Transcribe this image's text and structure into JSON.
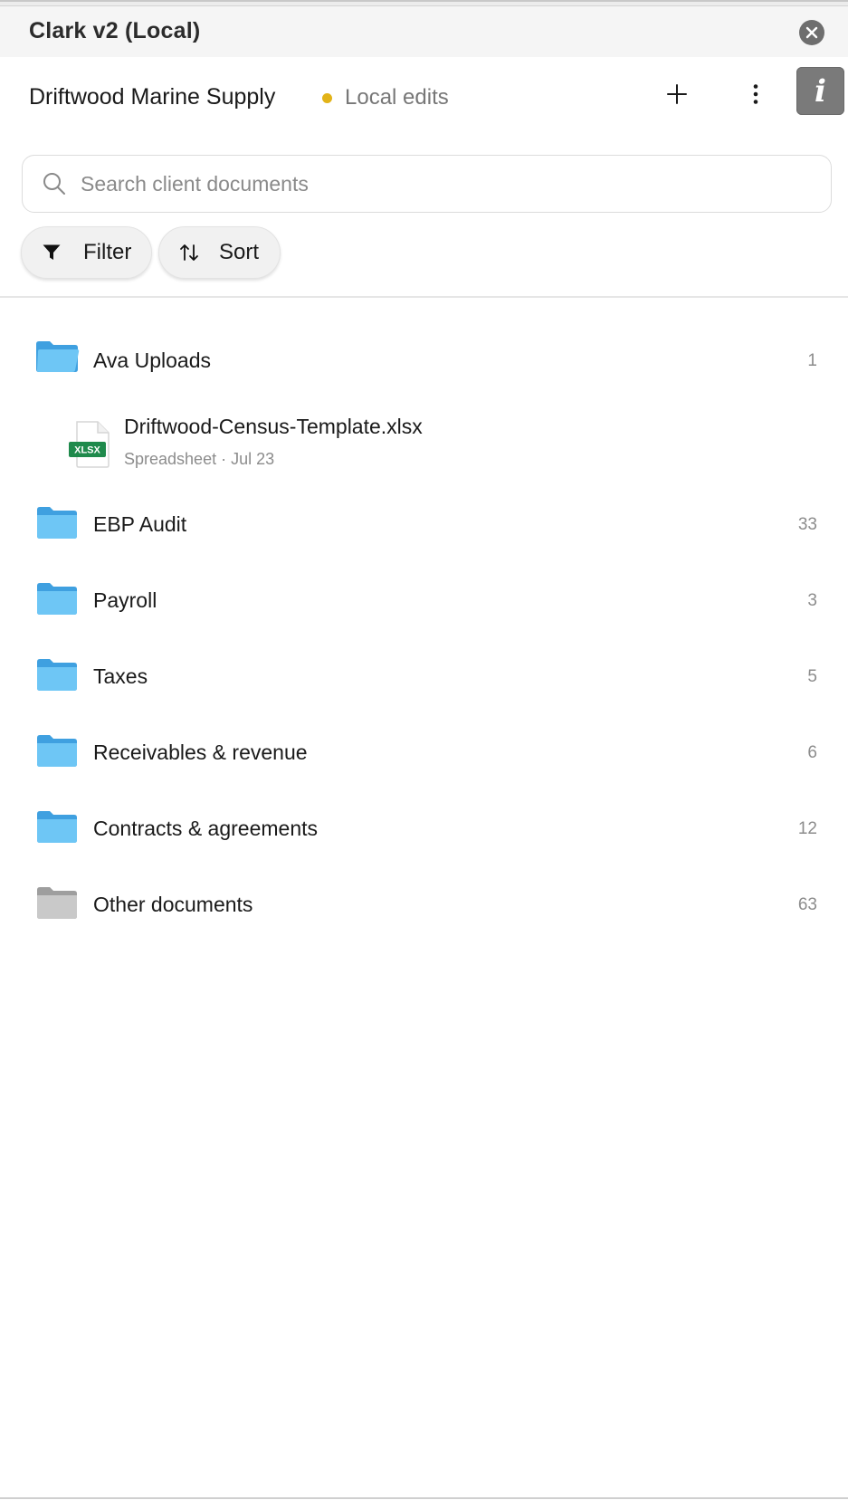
{
  "titlebar": {
    "title": "Clark v2 (Local)",
    "close_icon": "close-circle-icon"
  },
  "header": {
    "client_name": "Driftwood Marine Supply",
    "status_label": "Local edits",
    "status_color": "#e2b318",
    "add_icon": "plus-icon",
    "more_icon": "vertical-ellipsis-icon",
    "info_icon": "info-icon",
    "info_glyph": "i"
  },
  "search": {
    "placeholder": "Search client documents",
    "value": "",
    "icon": "search-icon"
  },
  "toolbar": {
    "filter_label": "Filter",
    "filter_icon": "funnel-icon",
    "sort_label": "Sort",
    "sort_icon": "sort-arrows-icon"
  },
  "folders": [
    {
      "name": "Ava Uploads",
      "count": "1",
      "color": "#5cb8ef",
      "expanded": true,
      "files": [
        {
          "name": "Driftwood-Census-Template.xlsx",
          "meta": "Spreadsheet · Jul 23",
          "badge": "XLSX",
          "badge_color": "#1f8a4c"
        }
      ]
    },
    {
      "name": "EBP Audit",
      "count": "33",
      "color": "#5cb8ef"
    },
    {
      "name": "Payroll",
      "count": "3",
      "color": "#5cb8ef"
    },
    {
      "name": "Taxes",
      "count": "5",
      "color": "#5cb8ef"
    },
    {
      "name": "Receivables & revenue",
      "count": "6",
      "color": "#5cb8ef"
    },
    {
      "name": "Contracts & agreements",
      "count": "12",
      "color": "#5cb8ef"
    },
    {
      "name": "Other documents",
      "count": "63",
      "color": "#b8b8b8"
    }
  ]
}
